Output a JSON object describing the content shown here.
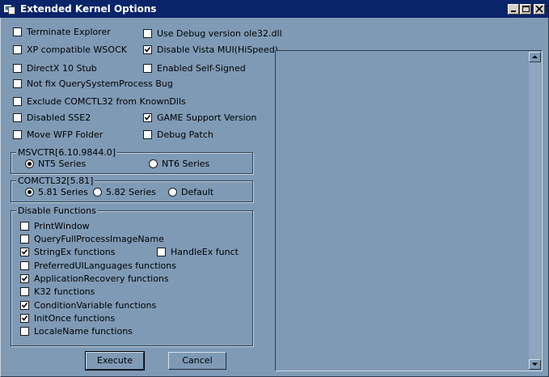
{
  "window": {
    "title": "Extended Kernel Options"
  },
  "options": {
    "terminate_explorer": {
      "label": "Terminate Explorer",
      "checked": false
    },
    "use_debug_ole32": {
      "label": "Use Debug version ole32.dll",
      "checked": false
    },
    "xp_wsock": {
      "label": "XP compatible WSOCK",
      "checked": false
    },
    "disable_vista_mui": {
      "label": "Disable Vista MUI(HiSpeed)",
      "checked": true
    },
    "directx10_stub": {
      "label": "DirectX 10 Stub",
      "checked": false
    },
    "enabled_self_signed": {
      "label": "Enabled Self-Signed",
      "checked": false
    },
    "not_fix_qsp": {
      "label": "Not fix QuerySystemProcess Bug",
      "checked": false
    },
    "exclude_comctl32": {
      "label": "Exclude COMCTL32 from KnownDlls",
      "checked": false
    },
    "disabled_sse2": {
      "label": "Disabled SSE2",
      "checked": false
    },
    "game_support": {
      "label": "GAME Support Version",
      "checked": true
    },
    "move_wfp": {
      "label": "Move WFP Folder",
      "checked": false
    },
    "debug_patch": {
      "label": "Debug Patch",
      "checked": false
    }
  },
  "msvcrt": {
    "legend": "MSVCTR[6.10.9844.0]",
    "options": [
      {
        "label": "NT5 Series",
        "selected": true
      },
      {
        "label": "NT6 Series",
        "selected": false
      }
    ]
  },
  "comctl32": {
    "legend": "COMCTL32[5.81]",
    "options": [
      {
        "label": "5.81 Series",
        "selected": true
      },
      {
        "label": "5.82 Series",
        "selected": false
      },
      {
        "label": "Default",
        "selected": false
      }
    ]
  },
  "disable_functions": {
    "legend": "Disable Functions",
    "items": [
      {
        "label": "PrintWindow",
        "checked": false
      },
      {
        "label": "QueryFullProcessImageName",
        "checked": false
      },
      {
        "label": "StringEx functions",
        "checked": true
      },
      {
        "label": "HandleEx funct",
        "checked": false
      },
      {
        "label": "PreferredUILanguages functions",
        "checked": false
      },
      {
        "label": "ApplicationRecovery functions",
        "checked": true
      },
      {
        "label": "K32 functions",
        "checked": false
      },
      {
        "label": "ConditionVariable functions",
        "checked": true
      },
      {
        "label": "InitOnce functions",
        "checked": true
      },
      {
        "label": "LocaleName functions",
        "checked": false
      }
    ]
  },
  "buttons": {
    "execute": "Execute",
    "cancel": "Cancel"
  },
  "colors": {
    "window_bg": "#7f9ab5",
    "titlebar": "#0a246a"
  }
}
